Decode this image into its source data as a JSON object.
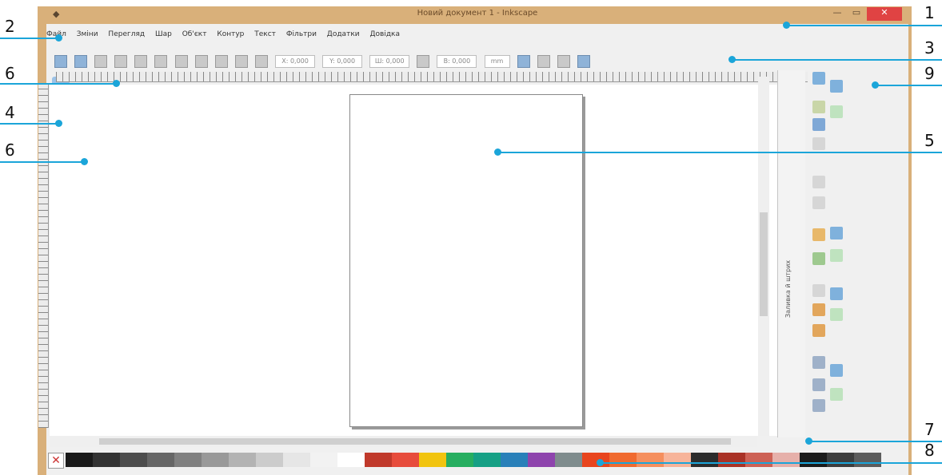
{
  "window": {
    "title": "Новий документ 1 - Inkscape",
    "minimize_glyph": "—",
    "maximize_glyph": "▭",
    "close_glyph": "✕",
    "app_icon": "inkscape-icon"
  },
  "menubar": [
    "Файл",
    "Зміни",
    "Перегляд",
    "Шар",
    "Об'єкт",
    "Контур",
    "Текст",
    "Фільтри",
    "Додатки",
    "Довідка"
  ],
  "command_bar": {
    "fields": [
      "X: 0,000",
      "Y: 0,000",
      "Ш: 0,000",
      "В: 0,000"
    ],
    "unit": "mm"
  },
  "docker": {
    "tab_label": "Заливка й штрих"
  },
  "palette": {
    "none_glyph": "✕",
    "colors": [
      "#1a1a1a",
      "#333333",
      "#4d4d4d",
      "#666666",
      "#808080",
      "#999999",
      "#b3b3b3",
      "#cccccc",
      "#e6e6e6",
      "#f2f2f2",
      "#ffffff",
      "#c0392b",
      "#e74c3c",
      "#f1c40f",
      "#27ae60",
      "#16a085",
      "#2980b9",
      "#8e44ad",
      "#7f8c8d",
      "#e8451e",
      "#f06a2f",
      "#f58f5e",
      "#f7b49a",
      "#2c2c2c",
      "#a93226",
      "#cd6155",
      "#e6b0aa",
      "#1b1b1b",
      "#3d3d3d",
      "#5c5c5c"
    ]
  },
  "callouts": [
    "1",
    "2",
    "3",
    "4",
    "5",
    "6",
    "6",
    "7",
    "8",
    "9"
  ],
  "accent": "#1ba5d9"
}
